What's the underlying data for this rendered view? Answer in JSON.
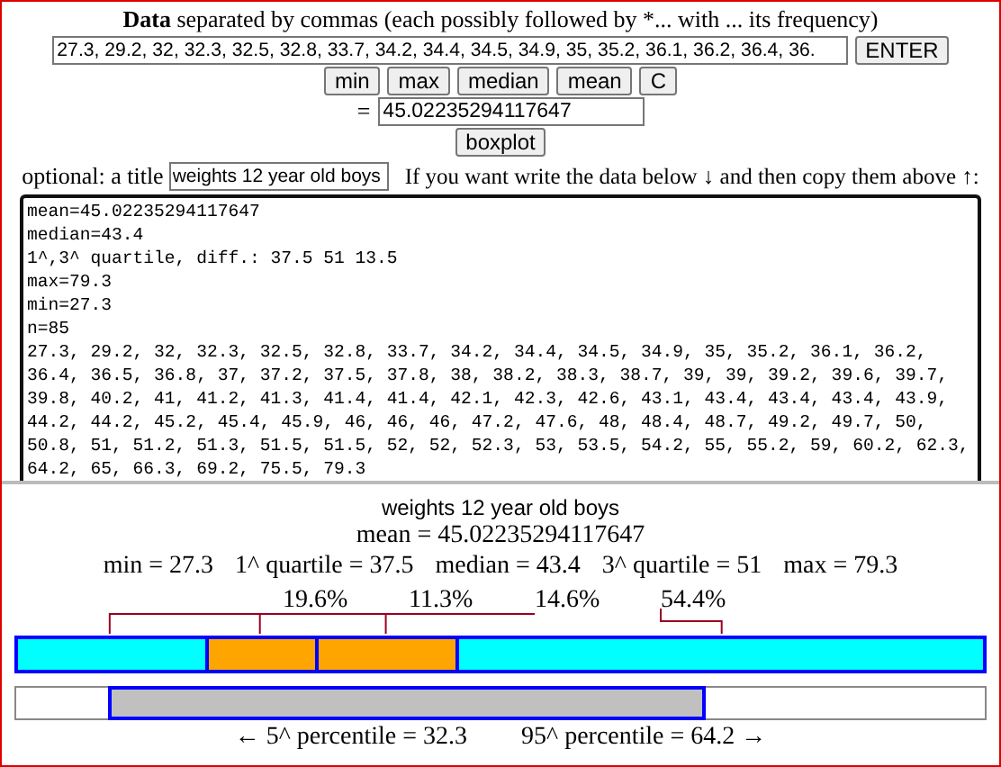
{
  "header": {
    "text": "**Data** separated by commas  (each possibly followed by *... with ... its frequency)"
  },
  "data_input": {
    "value": "27.3, 29.2, 32, 32.3, 32.5, 32.8, 33.7, 34.2, 34.4, 34.5, 34.9, 35, 35.2, 36.1, 36.2, 36.4, 36."
  },
  "enter_button": "ENTER",
  "function_buttons": [
    "min",
    "max",
    "median",
    "mean",
    "C"
  ],
  "result": {
    "label": "=",
    "value": "45.02235294117647"
  },
  "boxplot_button": "boxplot",
  "title_row": {
    "label": "optional: a title",
    "title_value": "weights 12 year old boys",
    "hint": "If you want write the data below ↓ and then copy them above ↑:"
  },
  "textarea": {
    "lines": [
      "mean=45.02235294117647",
      "median=43.4",
      "1^,3^ quartile, diff.: 37.5 51 13.5",
      "max=79.3",
      "min=27.3",
      "n=85",
      "27.3, 29.2, 32, 32.3, 32.5, 32.8, 33.7, 34.2, 34.4, 34.5, 34.9, 35, 35.2, 36.1, 36.2,",
      "36.4, 36.5, 36.8, 37, 37.2, 37.5, 37.8, 38, 38.2, 38.3, 38.7, 39, 39, 39.2, 39.6, 39.7,",
      "39.8, 40.2, 41, 41.2, 41.3, 41.4, 41.4, 42.1, 42.3, 42.6, 43.1, 43.4, 43.4, 43.4, 43.9,",
      "44.2, 44.2, 45.2, 45.4, 45.9, 46, 46, 46, 47.2, 47.6, 48, 48.4, 48.7, 49.2, 49.7, 50,",
      "50.8, 51, 51.2, 51.3, 51.5, 51.5, 52, 52, 52.3, 53, 53.5, 54.2, 55, 55.2, 59, 60.2, 62.3,",
      "64.2, 65, 66.3, 69.2, 75.5, 79.3"
    ]
  },
  "boxplot": {
    "title": "weights 12 year old boys",
    "mean": "mean = 45.02235294117647",
    "stats": [
      "min = 27.3",
      "1^ quartile = 37.5",
      "median = 43.4",
      "3^ quartile = 51",
      "max = 79.3"
    ],
    "percent_labels": [
      "19.6%",
      "11.3%",
      "14.6%",
      "54.4%"
    ],
    "segments": [
      {
        "color": "#00ffff"
      },
      {
        "color": "#ffa500"
      },
      {
        "color": "#ffa500"
      },
      {
        "color": "#00ffff"
      }
    ],
    "dividers": [
      {
        "level": 0.196
      },
      {
        "level": 0.309
      },
      {
        "level": 0.455
      }
    ],
    "percentile": {
      "lower": {
        "label": "← 5^ percentile = 32.3",
        "level": 0.096
      },
      "upper": {
        "label": "95^ percentile = 64.2 →",
        "level": 0.71
      }
    }
  }
}
